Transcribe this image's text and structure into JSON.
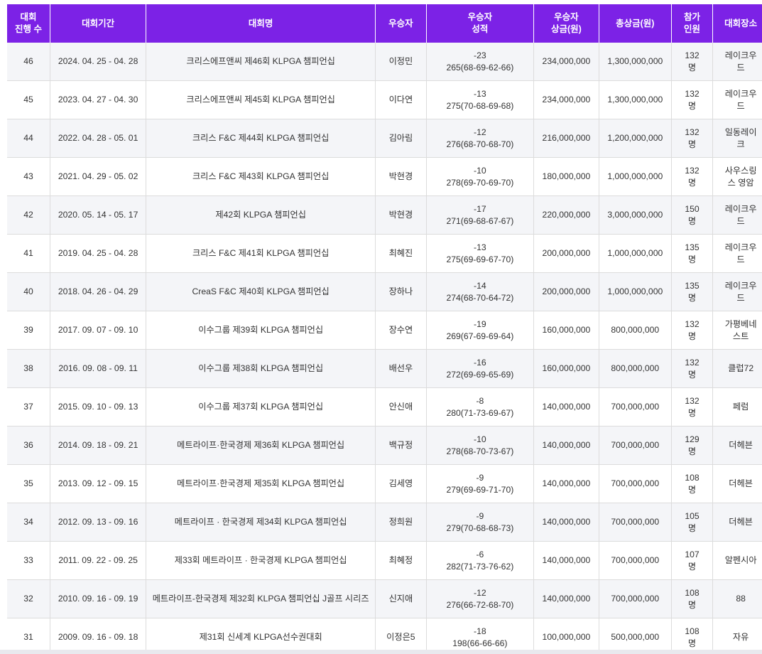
{
  "headers": {
    "round": [
      "대회",
      "진행 수"
    ],
    "period": "대회기간",
    "name": "대회명",
    "winner": "우승자",
    "score": [
      "우승자",
      "성적"
    ],
    "prize": [
      "우승자",
      "상금(원)"
    ],
    "total": "총상금(원)",
    "players": [
      "참가",
      "인원"
    ],
    "venue": "대회장소"
  },
  "rows": [
    {
      "round": "46",
      "period": "2024. 04. 25 - 04. 28",
      "name": "크리스에프앤씨 제46회 KLPGA 챔피언십",
      "winner": "이정민",
      "score": [
        "-23",
        "265(68-69-62-66)"
      ],
      "prize": "234,000,000",
      "total": "1,300,000,000",
      "players": [
        "132",
        "명"
      ],
      "venue": [
        "레이크우",
        "드"
      ]
    },
    {
      "round": "45",
      "period": "2023. 04. 27 - 04. 30",
      "name": "크리스에프앤씨 제45회 KLPGA 챔피언십",
      "winner": "이다연",
      "score": [
        "-13",
        "275(70-68-69-68)"
      ],
      "prize": "234,000,000",
      "total": "1,300,000,000",
      "players": [
        "132",
        "명"
      ],
      "venue": [
        "레이크우",
        "드"
      ]
    },
    {
      "round": "44",
      "period": "2022. 04. 28 - 05. 01",
      "name": "크리스 F&C 제44회 KLPGA 챔피언십",
      "winner": "김아림",
      "score": [
        "-12",
        "276(68-70-68-70)"
      ],
      "prize": "216,000,000",
      "total": "1,200,000,000",
      "players": [
        "132",
        "명"
      ],
      "venue": [
        "일동레이",
        "크"
      ]
    },
    {
      "round": "43",
      "period": "2021. 04. 29 - 05. 02",
      "name": "크리스 F&C 제43회 KLPGA 챔피언십",
      "winner": "박현경",
      "score": [
        "-10",
        "278(69-70-69-70)"
      ],
      "prize": "180,000,000",
      "total": "1,000,000,000",
      "players": [
        "132",
        "명"
      ],
      "venue": [
        "사우스링",
        "스 영암"
      ]
    },
    {
      "round": "42",
      "period": "2020. 05. 14 - 05. 17",
      "name": "제42회 KLPGA 챔피언십",
      "winner": "박현경",
      "score": [
        "-17",
        "271(69-68-67-67)"
      ],
      "prize": "220,000,000",
      "total": "3,000,000,000",
      "players": [
        "150",
        "명"
      ],
      "venue": [
        "레이크우",
        "드"
      ]
    },
    {
      "round": "41",
      "period": "2019. 04. 25 - 04. 28",
      "name": "크리스 F&C 제41회 KLPGA 챔피언십",
      "winner": "최혜진",
      "score": [
        "-13",
        "275(69-69-67-70)"
      ],
      "prize": "200,000,000",
      "total": "1,000,000,000",
      "players": [
        "135",
        "명"
      ],
      "venue": [
        "레이크우",
        "드"
      ]
    },
    {
      "round": "40",
      "period": "2018. 04. 26 - 04. 29",
      "name": "CreaS F&C 제40회 KLPGA 챔피언십",
      "winner": "장하나",
      "score": [
        "-14",
        "274(68-70-64-72)"
      ],
      "prize": "200,000,000",
      "total": "1,000,000,000",
      "players": [
        "135",
        "명"
      ],
      "venue": [
        "레이크우",
        "드"
      ]
    },
    {
      "round": "39",
      "period": "2017. 09. 07 - 09. 10",
      "name": "이수그룹 제39회 KLPGA 챔피언십",
      "winner": "장수연",
      "score": [
        "-19",
        "269(67-69-69-64)"
      ],
      "prize": "160,000,000",
      "total": "800,000,000",
      "players": [
        "132",
        "명"
      ],
      "venue": [
        "가평베네",
        "스트"
      ]
    },
    {
      "round": "38",
      "period": "2016. 09. 08 - 09. 11",
      "name": "이수그룹 제38회 KLPGA 챔피언십",
      "winner": "배선우",
      "score": [
        "-16",
        "272(69-69-65-69)"
      ],
      "prize": "160,000,000",
      "total": "800,000,000",
      "players": [
        "132",
        "명"
      ],
      "venue": [
        "클럽72",
        ""
      ]
    },
    {
      "round": "37",
      "period": "2015. 09. 10 - 09. 13",
      "name": "이수그룹 제37회 KLPGA 챔피언십",
      "winner": "안신애",
      "score": [
        "-8",
        "280(71-73-69-67)"
      ],
      "prize": "140,000,000",
      "total": "700,000,000",
      "players": [
        "132",
        "명"
      ],
      "venue": [
        "페럼",
        ""
      ]
    },
    {
      "round": "36",
      "period": "2014. 09. 18 - 09. 21",
      "name": "메트라이프·한국경제 제36회 KLPGA 챔피언십",
      "winner": "백규정",
      "score": [
        "-10",
        "278(68-70-73-67)"
      ],
      "prize": "140,000,000",
      "total": "700,000,000",
      "players": [
        "129",
        "명"
      ],
      "venue": [
        "더헤븐",
        ""
      ]
    },
    {
      "round": "35",
      "period": "2013. 09. 12 - 09. 15",
      "name": "메트라이프·한국경제 제35회 KLPGA 챔피언십",
      "winner": "김세영",
      "score": [
        "-9",
        "279(69-69-71-70)"
      ],
      "prize": "140,000,000",
      "total": "700,000,000",
      "players": [
        "108",
        "명"
      ],
      "venue": [
        "더헤븐",
        ""
      ]
    },
    {
      "round": "34",
      "period": "2012. 09. 13 - 09. 16",
      "name": "메트라이프 · 한국경제 제34회 KLPGA 챔피언십",
      "winner": "정희원",
      "score": [
        "-9",
        "279(70-68-68-73)"
      ],
      "prize": "140,000,000",
      "total": "700,000,000",
      "players": [
        "105",
        "명"
      ],
      "venue": [
        "더헤븐",
        ""
      ]
    },
    {
      "round": "33",
      "period": "2011. 09. 22 - 09. 25",
      "name": "제33회 메트라이프 · 한국경제 KLPGA 챔피언십",
      "winner": "최혜정",
      "score": [
        "-6",
        "282(71-73-76-62)"
      ],
      "prize": "140,000,000",
      "total": "700,000,000",
      "players": [
        "107",
        "명"
      ],
      "venue": [
        "알펜시아",
        ""
      ]
    },
    {
      "round": "32",
      "period": "2010. 09. 16 - 09. 19",
      "name": "메트라이프-한국경제 제32회 KLPGA 챔피언십 J골프 시리즈",
      "winner": "신지애",
      "score": [
        "-12",
        "276(66-72-68-70)"
      ],
      "prize": "140,000,000",
      "total": "700,000,000",
      "players": [
        "108",
        "명"
      ],
      "venue": [
        "88",
        ""
      ]
    },
    {
      "round": "31",
      "period": "2009. 09. 16 - 09. 18",
      "name": "제31회 신세계 KLPGA선수권대회",
      "winner": "이정은5",
      "score": [
        "-18",
        "198(66-66-66)"
      ],
      "prize": "100,000,000",
      "total": "500,000,000",
      "players": [
        "108",
        "명"
      ],
      "venue": [
        "자유",
        ""
      ]
    }
  ],
  "colors": {
    "header_bg": "#7c22e6",
    "header_text": "#ffffff",
    "row_alt": "#f4f5f8",
    "border": "#dcdcdc",
    "text": "#333333"
  }
}
